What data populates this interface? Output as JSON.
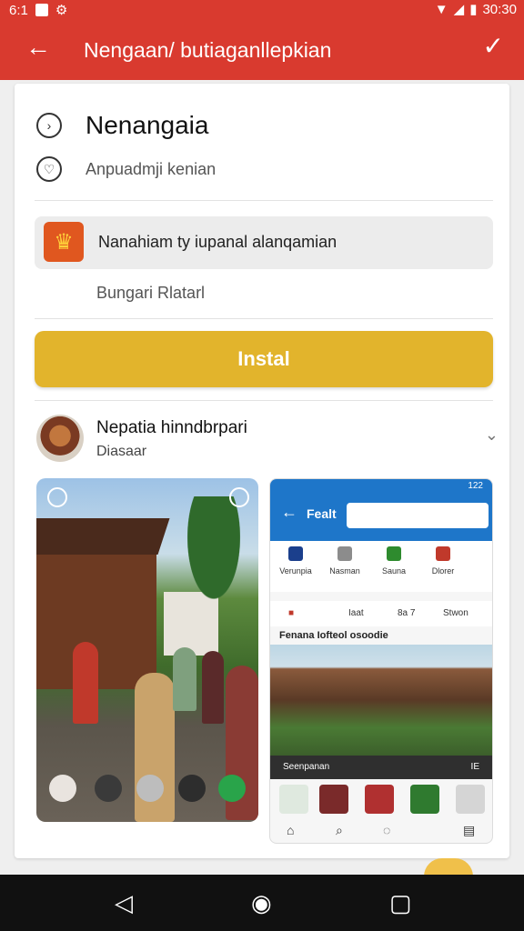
{
  "status_bar": {
    "time_left": "6:1",
    "time_right": "30:30"
  },
  "app_bar": {
    "title": "Nengaan/ butiaganllepkian"
  },
  "app": {
    "title": "Nenangaia",
    "subtitle": "Anpuadmji kenian",
    "info_text": "Nanahiam ty iupanal alanqamian",
    "rating_text": "Bungari Rlatarl",
    "install_label": "Instal"
  },
  "developer": {
    "name": "Nepatia hinndbrpari",
    "sub": "Diasaar"
  },
  "screenshot2": {
    "bar_text": "122",
    "title": "Fealt",
    "categories": [
      "Verunpia",
      "Nasman",
      "Sauna",
      "Dlorer"
    ],
    "tabs": [
      "Iaat",
      "8a 7",
      "Stwon"
    ],
    "caption": "Fenana Iofteol osoodie",
    "cap2_left": "Seenpanan",
    "cap2_right": "IE"
  },
  "colors": {
    "primary": "#d93a2f",
    "install": "#e2b42c",
    "screen_blue": "#1e76c9"
  },
  "icons": [
    "back-arrow-icon",
    "check-icon",
    "clock-icon",
    "heart-icon",
    "chevron-down-icon",
    "back-triangle-icon",
    "home-circle-icon",
    "recents-square-icon"
  ]
}
